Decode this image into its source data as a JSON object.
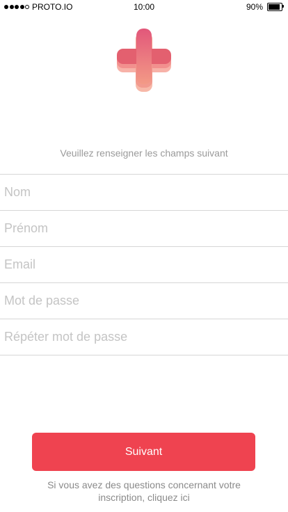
{
  "status_bar": {
    "carrier": "PROTO.IO",
    "time": "10:00",
    "battery_text": "90%",
    "battery_level": 0.9,
    "signal_bars_filled": 4,
    "signal_bars_total": 5
  },
  "logo": {
    "icon": "plus-cross-logo",
    "colors": [
      "#e45c6e",
      "#f38f8c",
      "#f6b1a6"
    ]
  },
  "form": {
    "instruction": "Veuillez renseigner les champs suivant",
    "fields": [
      {
        "placeholder": "Nom",
        "value": ""
      },
      {
        "placeholder": "Prénom",
        "value": ""
      },
      {
        "placeholder": "Email",
        "value": ""
      },
      {
        "placeholder": "Mot de passe",
        "value": ""
      },
      {
        "placeholder": "Répéter mot de passe",
        "value": ""
      }
    ]
  },
  "actions": {
    "next_label": "Suivant",
    "accent_color": "#ef4350"
  },
  "footer": {
    "help_text": "Si vous avez des questions concernant votre inscription, cliquez ici"
  }
}
